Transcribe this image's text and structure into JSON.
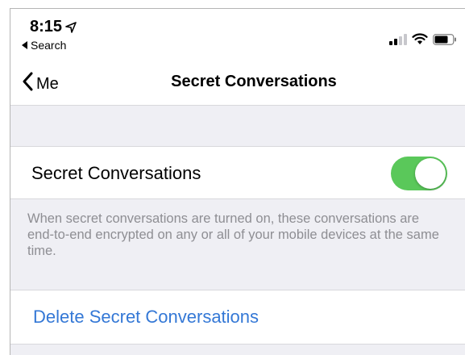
{
  "status_bar": {
    "time": "8:15",
    "back_app": "Search"
  },
  "nav": {
    "back_label": "Me",
    "title": "Secret Conversations"
  },
  "settings": {
    "toggle_label": "Secret Conversations",
    "toggle_on": true,
    "toggle_color": "#5ac85a",
    "footer": "When secret conversations are turned on, these conversations are end-to-end encrypted on any or all of your mobile devices at the same time.",
    "delete_label": "Delete Secret Conversations",
    "delete_color": "#3478d6"
  }
}
